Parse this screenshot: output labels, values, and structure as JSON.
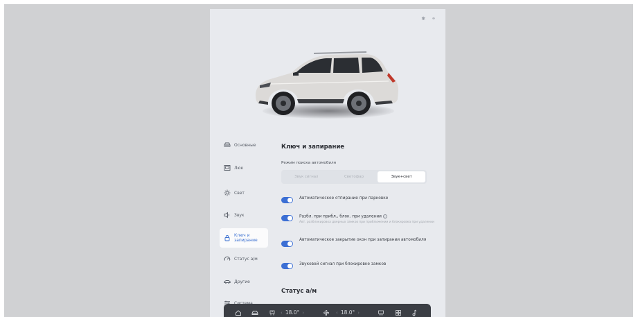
{
  "status_icons": [
    "bluetooth-icon",
    "link-icon"
  ],
  "sidebar": {
    "items": [
      {
        "label": "Основные",
        "icon": "car-front-icon",
        "active": false
      },
      {
        "label": "Люк",
        "icon": "sunroof-icon",
        "active": false
      },
      {
        "label": "Свет",
        "icon": "light-icon",
        "active": false
      },
      {
        "label": "Звук",
        "icon": "speaker-icon",
        "active": false
      },
      {
        "label": "Ключ и запирание",
        "icon": "lock-icon",
        "active": true
      },
      {
        "label": "Статус а/м",
        "icon": "gauge-icon",
        "active": false
      },
      {
        "label": "Другие",
        "icon": "car-side-icon",
        "active": false
      },
      {
        "label": "Система",
        "icon": "sliders-icon",
        "active": false
      }
    ]
  },
  "main": {
    "title": "Ключ и запирание",
    "search_mode_label": "Режим поиска автомобиля",
    "search_mode_options": [
      {
        "label": "Звук сигнал",
        "active": false
      },
      {
        "label": "Светофар",
        "active": false
      },
      {
        "label": "Звук+свет",
        "active": true
      }
    ],
    "toggles": [
      {
        "label": "Автоматическое отпирание при парковке",
        "note": "",
        "on": true
      },
      {
        "label": "Разбл. при прибл., блок. при удалении",
        "note": "Авт. разблокировка дверных замков при приближении и блокировка при удалении",
        "on": true
      },
      {
        "label": "Автоматическое закрытие окон при запирании автомобиля",
        "note": "",
        "on": true
      },
      {
        "label": "Звуковой сигнал при блокировке замков",
        "note": "",
        "on": true
      }
    ],
    "section2_title": "Статус а/м"
  },
  "bottombar": {
    "left_temp": "18.0°",
    "right_temp": "18.0°",
    "arrow_left": "‹",
    "arrow_right": "›",
    "icons": [
      "home-icon",
      "car-icon",
      "seat-heat-icon",
      "fan-icon",
      "rear-defrost-icon",
      "grid-icon",
      "music-icon"
    ]
  },
  "colors": {
    "accent": "#3c6fd4",
    "screen_bg": "#e8eaee",
    "bottombar_bg": "#3b3e44"
  }
}
